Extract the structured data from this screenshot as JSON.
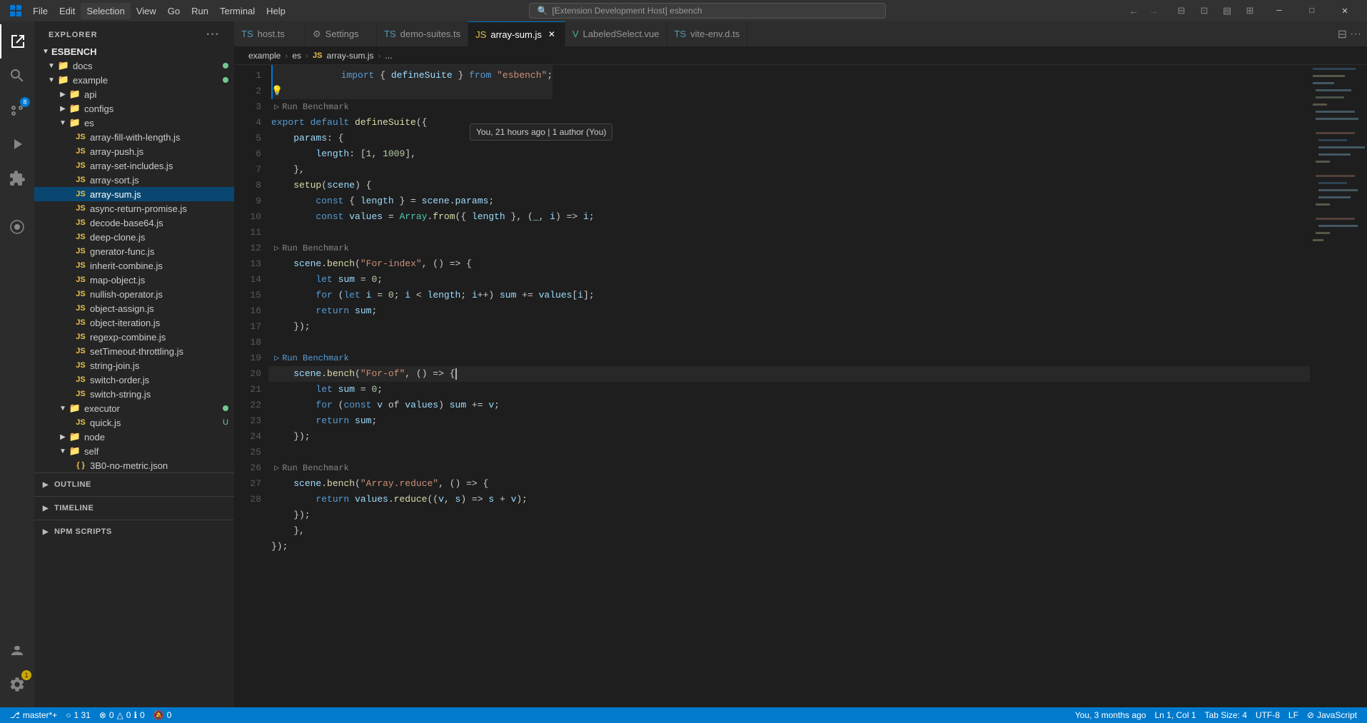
{
  "titlebar": {
    "menus": [
      "File",
      "Edit",
      "Selection",
      "View",
      "Go",
      "Run",
      "Terminal",
      "Help"
    ],
    "search_placeholder": "[Extension Development Host] esbench",
    "win_buttons": [
      "─",
      "□",
      "✕"
    ]
  },
  "activity_bar": {
    "icons": [
      {
        "name": "explorer",
        "symbol": "⎘",
        "active": true
      },
      {
        "name": "search",
        "symbol": "🔍"
      },
      {
        "name": "source-control",
        "symbol": "⑂",
        "badge": "8"
      },
      {
        "name": "run",
        "symbol": "▷"
      },
      {
        "name": "extensions",
        "symbol": "⊞"
      },
      {
        "name": "esbench",
        "symbol": "◈"
      },
      {
        "name": "accounts",
        "symbol": "👤"
      },
      {
        "name": "settings",
        "symbol": "⚙",
        "badge_warn": "1"
      }
    ]
  },
  "sidebar": {
    "title": "EXPLORER",
    "root": "ESBENCH",
    "tree": [
      {
        "level": 1,
        "label": "docs",
        "type": "folder",
        "open": true,
        "modified": true
      },
      {
        "level": 1,
        "label": "example",
        "type": "folder",
        "open": true,
        "modified": true
      },
      {
        "level": 2,
        "label": "api",
        "type": "folder",
        "open": false
      },
      {
        "level": 2,
        "label": "configs",
        "type": "folder",
        "open": false
      },
      {
        "level": 2,
        "label": "es",
        "type": "folder",
        "open": true
      },
      {
        "level": 3,
        "label": "array-fill-with-length.js",
        "type": "js"
      },
      {
        "level": 3,
        "label": "array-push.js",
        "type": "js"
      },
      {
        "level": 3,
        "label": "array-set-includes.js",
        "type": "js"
      },
      {
        "level": 3,
        "label": "array-sort.js",
        "type": "js"
      },
      {
        "level": 3,
        "label": "array-sum.js",
        "type": "js",
        "active": true
      },
      {
        "level": 3,
        "label": "async-return-promise.js",
        "type": "js"
      },
      {
        "level": 3,
        "label": "decode-base64.js",
        "type": "js"
      },
      {
        "level": 3,
        "label": "deep-clone.js",
        "type": "js"
      },
      {
        "level": 3,
        "label": "gnerator-func.js",
        "type": "js"
      },
      {
        "level": 3,
        "label": "inherit-combine.js",
        "type": "js"
      },
      {
        "level": 3,
        "label": "map-object.js",
        "type": "js"
      },
      {
        "level": 3,
        "label": "nullish-operator.js",
        "type": "js"
      },
      {
        "level": 3,
        "label": "object-assign.js",
        "type": "js"
      },
      {
        "level": 3,
        "label": "object-iteration.js",
        "type": "js"
      },
      {
        "level": 3,
        "label": "regexp-combine.js",
        "type": "js"
      },
      {
        "level": 3,
        "label": "setTimeout-throttling.js",
        "type": "js"
      },
      {
        "level": 3,
        "label": "string-join.js",
        "type": "js"
      },
      {
        "level": 3,
        "label": "switch-order.js",
        "type": "js"
      },
      {
        "level": 3,
        "label": "switch-string.js",
        "type": "js"
      },
      {
        "level": 2,
        "label": "executor",
        "type": "folder",
        "open": true,
        "modified": true
      },
      {
        "level": 3,
        "label": "quick.js",
        "type": "js",
        "untracked": true
      },
      {
        "level": 2,
        "label": "node",
        "type": "folder",
        "open": false
      },
      {
        "level": 2,
        "label": "self",
        "type": "folder",
        "open": true
      },
      {
        "level": 3,
        "label": "3B0-no-metric.json",
        "type": "json"
      }
    ],
    "sections": [
      {
        "label": "OUTLINE"
      },
      {
        "label": "TIMELINE"
      },
      {
        "label": "NPM SCRIPTS"
      }
    ]
  },
  "tabs": [
    {
      "label": "host.ts",
      "type": "ts",
      "closable": false
    },
    {
      "label": "Settings",
      "type": "gear",
      "closable": false
    },
    {
      "label": "demo-suites.ts",
      "type": "ts",
      "closable": false
    },
    {
      "label": "array-sum.js",
      "type": "js",
      "active": true,
      "closable": true
    },
    {
      "label": "LabeledSelect.vue",
      "type": "vue",
      "closable": false
    },
    {
      "label": "vite-env.d.ts",
      "type": "ts",
      "closable": false
    }
  ],
  "breadcrumb": {
    "parts": [
      "example",
      "es",
      "array-sum.js",
      "..."
    ]
  },
  "git_tooltip": "You, 21 hours ago | 1 author (You)",
  "code": {
    "lines": [
      {
        "num": 1,
        "tokens": [
          {
            "t": "kw",
            "v": "import"
          },
          {
            "t": "op",
            "v": " { "
          },
          {
            "t": "var",
            "v": "defineSuite"
          },
          {
            "t": "op",
            "v": " } "
          },
          {
            "t": "kw",
            "v": "from"
          },
          {
            "t": "op",
            "v": " "
          },
          {
            "t": "str",
            "v": "\"esbench\""
          },
          {
            "t": "op",
            "v": ";"
          }
        ]
      },
      {
        "num": 2,
        "tokens": []
      },
      {
        "num": 3,
        "tokens": [
          {
            "t": "kw",
            "v": "export"
          },
          {
            "t": "op",
            "v": " "
          },
          {
            "t": "kw",
            "v": "default"
          },
          {
            "t": "op",
            "v": " "
          },
          {
            "t": "fn",
            "v": "defineSuite"
          },
          {
            "t": "op",
            "v": "({"
          }
        ],
        "annotation": ""
      },
      {
        "num": 4,
        "tokens": [
          {
            "t": "op",
            "v": "    "
          },
          {
            "t": "var",
            "v": "params"
          },
          {
            "t": "op",
            "v": ": {"
          }
        ]
      },
      {
        "num": 5,
        "tokens": [
          {
            "t": "op",
            "v": "        "
          },
          {
            "t": "prop",
            "v": "length"
          },
          {
            "t": "op",
            "v": ": ["
          },
          {
            "t": "num",
            "v": "1"
          },
          {
            "t": "op",
            "v": ", "
          },
          {
            "t": "num",
            "v": "1009"
          },
          {
            "t": "op",
            "v": "],"
          }
        ]
      },
      {
        "num": 6,
        "tokens": [
          {
            "t": "op",
            "v": "    },"
          }
        ]
      },
      {
        "num": 7,
        "tokens": [
          {
            "t": "op",
            "v": "    "
          },
          {
            "t": "fn",
            "v": "setup"
          },
          {
            "t": "op",
            "v": "("
          },
          {
            "t": "var",
            "v": "scene"
          },
          {
            "t": "op",
            "v": ") {"
          }
        ]
      },
      {
        "num": 8,
        "tokens": [
          {
            "t": "op",
            "v": "        "
          },
          {
            "t": "kw",
            "v": "const"
          },
          {
            "t": "op",
            "v": " { "
          },
          {
            "t": "var",
            "v": "length"
          },
          {
            "t": "op",
            "v": " } = "
          },
          {
            "t": "var",
            "v": "scene"
          },
          {
            "t": "op",
            "v": "."
          },
          {
            "t": "prop",
            "v": "params"
          },
          {
            "t": "op",
            "v": ";"
          }
        ]
      },
      {
        "num": 9,
        "tokens": [
          {
            "t": "op",
            "v": "        "
          },
          {
            "t": "kw",
            "v": "const"
          },
          {
            "t": "op",
            "v": " "
          },
          {
            "t": "var",
            "v": "values"
          },
          {
            "t": "op",
            "v": " = "
          },
          {
            "t": "obj",
            "v": "Array"
          },
          {
            "t": "op",
            "v": "."
          },
          {
            "t": "fn",
            "v": "from"
          },
          {
            "t": "op",
            "v": "({ "
          },
          {
            "t": "var",
            "v": "length"
          },
          {
            "t": "op",
            "v": " }, ("
          },
          {
            "t": "var",
            "v": "_"
          },
          {
            "t": "op",
            "v": ", "
          },
          {
            "t": "var",
            "v": "i"
          },
          {
            "t": "op",
            "v": ") => "
          },
          {
            "t": "var",
            "v": "i"
          },
          {
            "t": "op",
            "v": ";"
          }
        ]
      },
      {
        "num": 10,
        "tokens": []
      },
      {
        "num": 11,
        "tokens": [
          {
            "t": "op",
            "v": "    "
          },
          {
            "t": "var",
            "v": "scene"
          },
          {
            "t": "op",
            "v": "."
          },
          {
            "t": "fn",
            "v": "bench"
          },
          {
            "t": "op",
            "v": "("
          },
          {
            "t": "str",
            "v": "\"For-index\""
          },
          {
            "t": "op",
            "v": ", () => {"
          }
        ],
        "run_bench": "Run Benchmark"
      },
      {
        "num": 12,
        "tokens": [
          {
            "t": "op",
            "v": "        "
          },
          {
            "t": "kw",
            "v": "let"
          },
          {
            "t": "op",
            "v": " "
          },
          {
            "t": "var",
            "v": "sum"
          },
          {
            "t": "op",
            "v": " = "
          },
          {
            "t": "num",
            "v": "0"
          },
          {
            "t": "op",
            "v": ";"
          }
        ]
      },
      {
        "num": 13,
        "tokens": [
          {
            "t": "op",
            "v": "        "
          },
          {
            "t": "kw",
            "v": "for"
          },
          {
            "t": "op",
            "v": " ("
          },
          {
            "t": "kw",
            "v": "let"
          },
          {
            "t": "op",
            "v": " "
          },
          {
            "t": "var",
            "v": "i"
          },
          {
            "t": "op",
            "v": " = "
          },
          {
            "t": "num",
            "v": "0"
          },
          {
            "t": "op",
            "v": "; "
          },
          {
            "t": "var",
            "v": "i"
          },
          {
            "t": "op",
            "v": " < "
          },
          {
            "t": "var",
            "v": "length"
          },
          {
            "t": "op",
            "v": "; "
          },
          {
            "t": "var",
            "v": "i"
          },
          {
            "t": "op",
            "v": "++) "
          },
          {
            "t": "var",
            "v": "sum"
          },
          {
            "t": "op",
            "v": " += "
          },
          {
            "t": "var",
            "v": "values"
          },
          {
            "t": "op",
            "v": "["
          },
          {
            "t": "var",
            "v": "i"
          },
          {
            "t": "op",
            "v": "];"
          }
        ]
      },
      {
        "num": 14,
        "tokens": [
          {
            "t": "op",
            "v": "        "
          },
          {
            "t": "kw",
            "v": "return"
          },
          {
            "t": "op",
            "v": " "
          },
          {
            "t": "var",
            "v": "sum"
          },
          {
            "t": "op",
            "v": ";"
          }
        ]
      },
      {
        "num": 15,
        "tokens": [
          {
            "t": "op",
            "v": "    });"
          }
        ]
      },
      {
        "num": 16,
        "tokens": []
      },
      {
        "num": 17,
        "tokens": [
          {
            "t": "op",
            "v": "    "
          },
          {
            "t": "var",
            "v": "scene"
          },
          {
            "t": "op",
            "v": "."
          },
          {
            "t": "fn",
            "v": "bench"
          },
          {
            "t": "op",
            "v": "("
          },
          {
            "t": "str",
            "v": "\"For-of\""
          },
          {
            "t": "op",
            "v": ", () => {"
          }
        ],
        "run_bench": "Run Benchmark"
      },
      {
        "num": 18,
        "tokens": [
          {
            "t": "op",
            "v": "        "
          },
          {
            "t": "kw",
            "v": "let"
          },
          {
            "t": "op",
            "v": " "
          },
          {
            "t": "var",
            "v": "sum"
          },
          {
            "t": "op",
            "v": " = "
          },
          {
            "t": "num",
            "v": "0"
          },
          {
            "t": "op",
            "v": ";"
          }
        ]
      },
      {
        "num": 19,
        "tokens": [
          {
            "t": "op",
            "v": "        "
          },
          {
            "t": "kw",
            "v": "for"
          },
          {
            "t": "op",
            "v": " ("
          },
          {
            "t": "kw",
            "v": "const"
          },
          {
            "t": "op",
            "v": " "
          },
          {
            "t": "var",
            "v": "v"
          },
          {
            "t": "op",
            "v": " of "
          },
          {
            "t": "var",
            "v": "values"
          },
          {
            "t": "op",
            "v": ") "
          },
          {
            "t": "var",
            "v": "sum"
          },
          {
            "t": "op",
            "v": " += "
          },
          {
            "t": "var",
            "v": "v"
          },
          {
            "t": "op",
            "v": ";"
          }
        ]
      },
      {
        "num": 20,
        "tokens": [
          {
            "t": "op",
            "v": "        "
          },
          {
            "t": "kw",
            "v": "return"
          },
          {
            "t": "op",
            "v": " "
          },
          {
            "t": "var",
            "v": "sum"
          },
          {
            "t": "op",
            "v": ";"
          }
        ]
      },
      {
        "num": 21,
        "tokens": [
          {
            "t": "op",
            "v": "    });"
          }
        ]
      },
      {
        "num": 22,
        "tokens": []
      },
      {
        "num": 23,
        "tokens": [
          {
            "t": "op",
            "v": "    "
          },
          {
            "t": "var",
            "v": "scene"
          },
          {
            "t": "op",
            "v": "."
          },
          {
            "t": "fn",
            "v": "bench"
          },
          {
            "t": "op",
            "v": "("
          },
          {
            "t": "str",
            "v": "\"Array.reduce\""
          },
          {
            "t": "op",
            "v": ", () => {"
          }
        ],
        "run_bench": "Run Benchmark"
      },
      {
        "num": 24,
        "tokens": [
          {
            "t": "op",
            "v": "        "
          },
          {
            "t": "kw",
            "v": "return"
          },
          {
            "t": "op",
            "v": " "
          },
          {
            "t": "var",
            "v": "values"
          },
          {
            "t": "op",
            "v": "."
          },
          {
            "t": "fn",
            "v": "reduce"
          },
          {
            "t": "op",
            "v": "(("
          },
          {
            "t": "var",
            "v": "v"
          },
          {
            "t": "op",
            "v": ", "
          },
          {
            "t": "var",
            "v": "s"
          },
          {
            "t": "op",
            "v": ") => "
          },
          {
            "t": "var",
            "v": "s"
          },
          {
            "t": "op",
            "v": " + "
          },
          {
            "t": "var",
            "v": "v"
          },
          {
            "t": "op",
            "v": ");"
          }
        ]
      },
      {
        "num": 25,
        "tokens": [
          {
            "t": "op",
            "v": "    });"
          }
        ]
      },
      {
        "num": 26,
        "tokens": [
          {
            "t": "op",
            "v": "    },"
          }
        ]
      },
      {
        "num": 27,
        "tokens": [
          {
            "t": "op",
            "v": "});"
          }
        ]
      },
      {
        "num": 28,
        "tokens": []
      }
    ]
  },
  "status_bar": {
    "left": [
      {
        "label": "⎇ master*+",
        "icon": "git-branch"
      },
      {
        "label": "○ 1 31"
      },
      {
        "label": "⚠ 0 ⊗ 0 △ 0"
      },
      {
        "label": "⊘ 0"
      }
    ],
    "right": [
      {
        "label": "You, 3 months ago"
      },
      {
        "label": "Ln 1, Col 1"
      },
      {
        "label": "Tab Size: 4"
      },
      {
        "label": "UTF-8"
      },
      {
        "label": "LF"
      },
      {
        "label": "⊘ JavaScript"
      }
    ]
  }
}
